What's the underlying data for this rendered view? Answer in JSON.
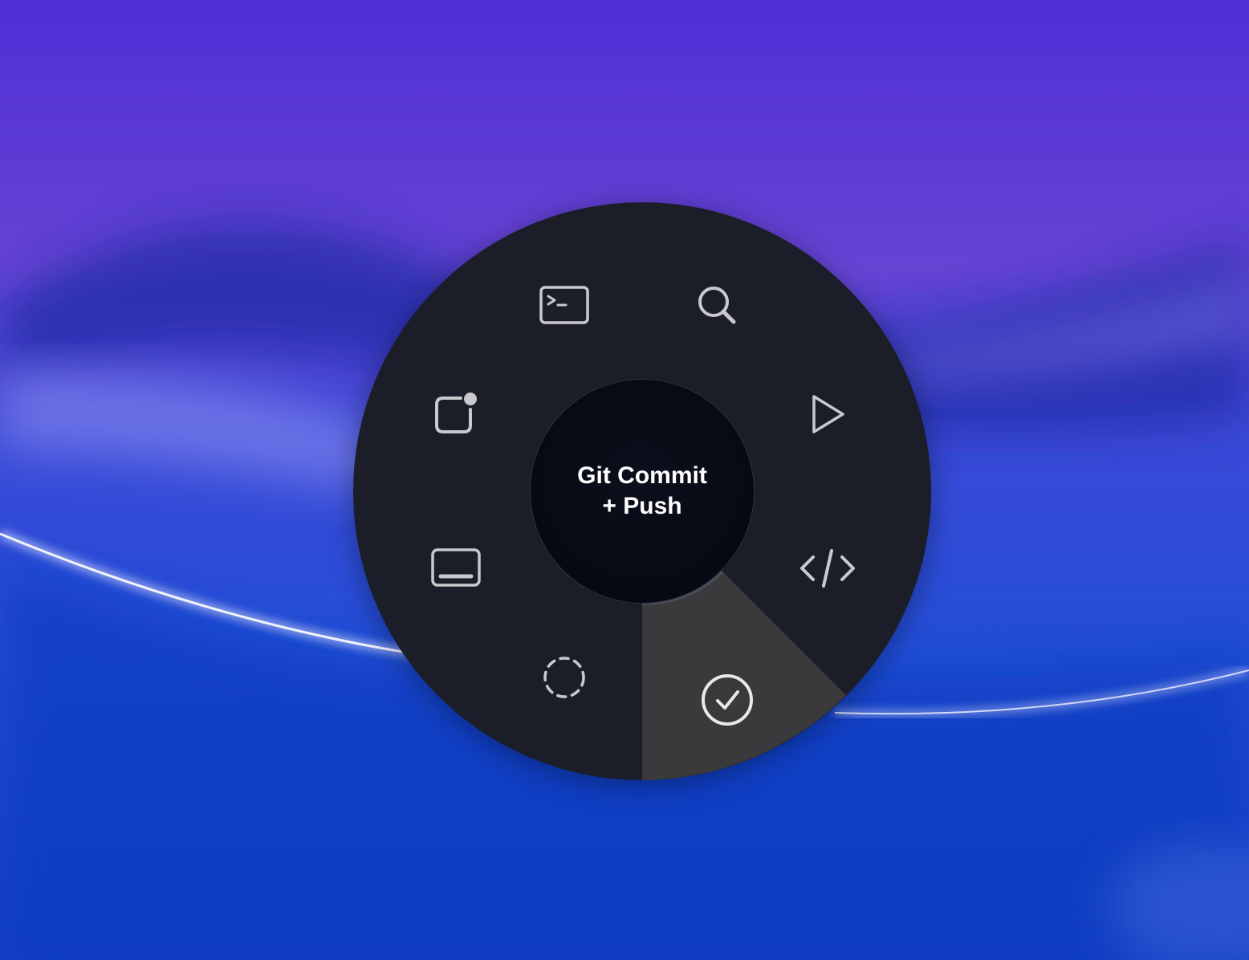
{
  "colors": {
    "wallpaper_top": "#4f2fd6",
    "wallpaper_mid": "#2f3fd0",
    "wallpaper_bottom": "#0d3fc4",
    "menu_bg": "#1b1d29",
    "hub_bg": "#070912",
    "selected_segment": "#3a3a3c",
    "icon_stroke": "#c9c9cd",
    "text": "#ffffff"
  },
  "hub": {
    "line1": "Git Commit",
    "line2": "+ Push"
  },
  "menu": {
    "selected": "checkmark-circle-icon",
    "items": [
      {
        "icon": "terminal-icon"
      },
      {
        "icon": "search-icon"
      },
      {
        "icon": "play-icon"
      },
      {
        "icon": "code-brackets-icon"
      },
      {
        "icon": "checkmark-circle-icon"
      },
      {
        "icon": "dashed-circle-icon"
      },
      {
        "icon": "window-bottom-panel-icon"
      },
      {
        "icon": "notification-square-icon"
      }
    ]
  }
}
